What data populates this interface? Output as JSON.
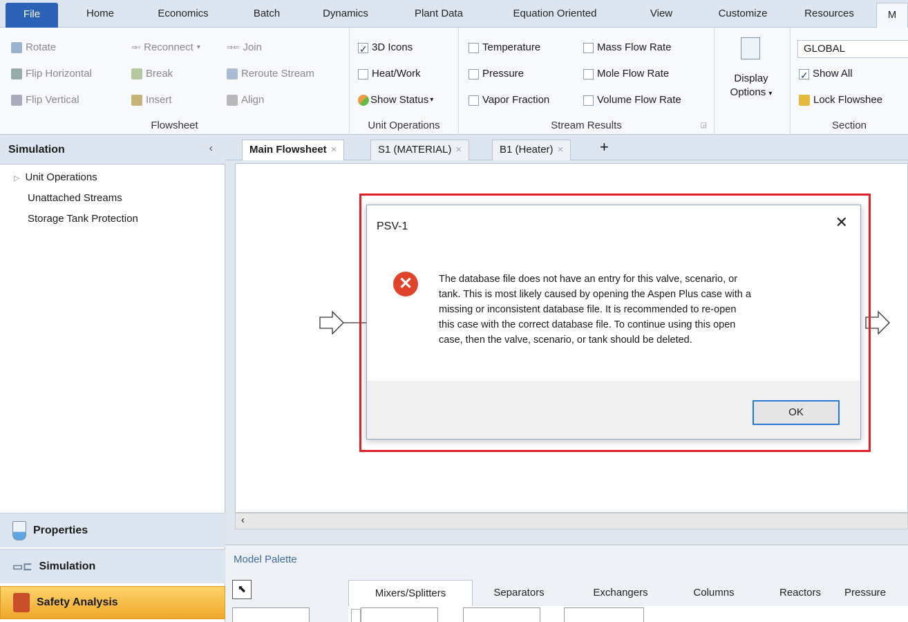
{
  "ribbon_tabs": [
    "File",
    "Home",
    "Economics",
    "Batch",
    "Dynamics",
    "Plant Data",
    "Equation Oriented",
    "View",
    "Customize",
    "Resources",
    "M"
  ],
  "ribbon": {
    "flowsheet": {
      "rotate": "Rotate",
      "flip_h": "Flip Horizontal",
      "flip_v": "Flip Vertical",
      "reconnect": "Reconnect",
      "join": "Join",
      "break": "Break",
      "reroute": "Reroute Stream",
      "insert": "Insert",
      "align": "Align",
      "label": "Flowsheet"
    },
    "unit_ops": {
      "icons3d": "3D Icons",
      "heatwork": "Heat/Work",
      "show_status": "Show Status",
      "label": "Unit Operations"
    },
    "stream_results": {
      "temperature": "Temperature",
      "pressure": "Pressure",
      "vapor_fraction": "Vapor Fraction",
      "mass_flow": "Mass Flow Rate",
      "mole_flow": "Mole Flow Rate",
      "volume_flow": "Volume Flow Rate",
      "label": "Stream Results"
    },
    "display_options": {
      "line1": "Display",
      "line2": "Options"
    },
    "section": {
      "global": "GLOBAL",
      "show_all": "Show All",
      "lock_flowsheet": "Lock Flowshee",
      "label": "Section"
    }
  },
  "nav": {
    "header": "Simulation",
    "tree": [
      "Unit Operations",
      "Unattached Streams",
      "Storage Tank Protection"
    ],
    "buttons": [
      "Properties",
      "Simulation",
      "Safety Analysis"
    ]
  },
  "doc_tabs": [
    "Main Flowsheet",
    "S1 (MATERIAL)",
    "B1 (Heater)"
  ],
  "dialog": {
    "title": "PSV-1",
    "message_lines": [
      "The database file does not have an entry for this valve, scenario, or",
      "tank. This is most likely caused by opening the Aspen Plus case with a",
      "missing or inconsistent database file. It is recommended to re-open",
      "this case with the correct database file. To continue using this open",
      "case, then the valve, scenario, or tank should be deleted."
    ],
    "ok": "OK"
  },
  "palette": {
    "title": "Model Palette",
    "tabs": [
      "Mixers/Splitters",
      "Separators",
      "Exchangers",
      "Columns",
      "Reactors",
      "Pressure"
    ]
  },
  "colors": {
    "file_tab": "#2b62b5",
    "active_nav": "#f0a82b",
    "highlight_border": "#e01f26",
    "error_icon": "#e0432c"
  }
}
